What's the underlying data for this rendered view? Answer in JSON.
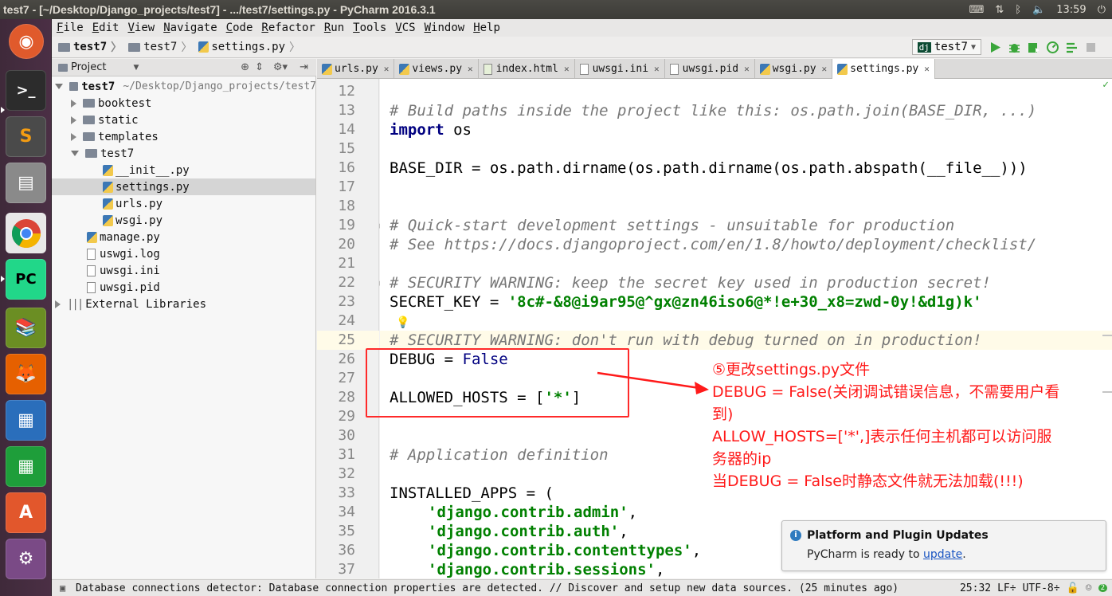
{
  "window": {
    "title": "test7 - [~/Desktop/Django_projects/test7] - .../test7/settings.py - PyCharm 2016.3.1"
  },
  "tray": {
    "time": "13:59"
  },
  "menu": [
    "File",
    "Edit",
    "View",
    "Navigate",
    "Code",
    "Refactor",
    "Run",
    "Tools",
    "VCS",
    "Window",
    "Help"
  ],
  "breadcrumb": [
    "test7",
    "test7",
    "settings.py"
  ],
  "run_config": "test7",
  "project_panel": {
    "header": "Project",
    "root_name": "test7",
    "root_path": "~/Desktop/Django_projects/test7",
    "items": [
      "booktest",
      "static",
      "templates",
      "test7",
      "__init__.py",
      "settings.py",
      "urls.py",
      "wsgi.py",
      "manage.py",
      "uswgi.log",
      "uwsgi.ini",
      "uwsgi.pid",
      "External Libraries"
    ]
  },
  "tabs": [
    "urls.py",
    "views.py",
    "index.html",
    "uwsgi.ini",
    "uwsgi.pid",
    "wsgi.py",
    "settings.py"
  ],
  "editor": {
    "line_numbers": [
      "12",
      "13",
      "14",
      "15",
      "16",
      "17",
      "18",
      "19",
      "20",
      "21",
      "22",
      "23",
      "24",
      "25",
      "26",
      "27",
      "28",
      "29",
      "30",
      "31",
      "32",
      "33",
      "34",
      "35",
      "36",
      "37"
    ],
    "lines": {
      "l13": "# Build paths inside the project like this: os.path.join(BASE_DIR, ...)",
      "l14_kw": "import",
      "l14_rest": " os",
      "l16": "BASE_DIR = os.path.dirname(os.path.dirname(os.path.abspath(__file__)))",
      "l19": "# Quick-start development settings - unsuitable for production",
      "l20": "# See https://docs.djangoproject.com/en/1.8/howto/deployment/checklist/",
      "l22": "# SECURITY WARNING: keep the secret key used in production secret!",
      "l23_a": "SECRET_KEY = ",
      "l23_str": "'8c#-&8@i9ar95@^gx@zn46iso6@*!e+30_x8=zwd-0y!&d1g)k'",
      "l25": "# SECURITY WARNING: don't run with debug turned on in production!",
      "l26_a": "DEBUG = ",
      "l26_b": "False",
      "l28_a": "ALLOWED_HOSTS = [",
      "l28_str": "'*'",
      "l28_b": "]",
      "l31": "# Application definition",
      "l33": "INSTALLED_APPS = (",
      "l34": "'django.contrib.admin'",
      "l35": "'django.contrib.auth'",
      "l36": "'django.contrib.contenttypes'",
      "l37": "'django.contrib.sessions'",
      "comma": ","
    }
  },
  "annotation": {
    "line1": "⑤更改settings.py文件",
    "line2": "DEBUG = False(关闭调试错误信息，不需要用户看",
    "line3": "到)",
    "line4": "ALLOW_HOSTS=['*',]表示任何主机都可以访问服",
    "line5": "务器的ip",
    "line6": "当DEBUG = False时静态文件就无法加载(!!!)"
  },
  "notification": {
    "title": "Platform and Plugin Updates",
    "body_prefix": "PyCharm is ready to ",
    "link": "update",
    "body_suffix": "."
  },
  "statusbar": {
    "message": "Database connections detector: Database connection properties are detected. // Discover and setup new data sources. (25 minutes ago)",
    "position": "25:32",
    "line_sep": "LF÷",
    "encoding": "UTF-8÷"
  },
  "colors": {
    "annotation_red": "#ff1a1a",
    "string_green": "#008000",
    "keyword_blue": "#000080"
  }
}
